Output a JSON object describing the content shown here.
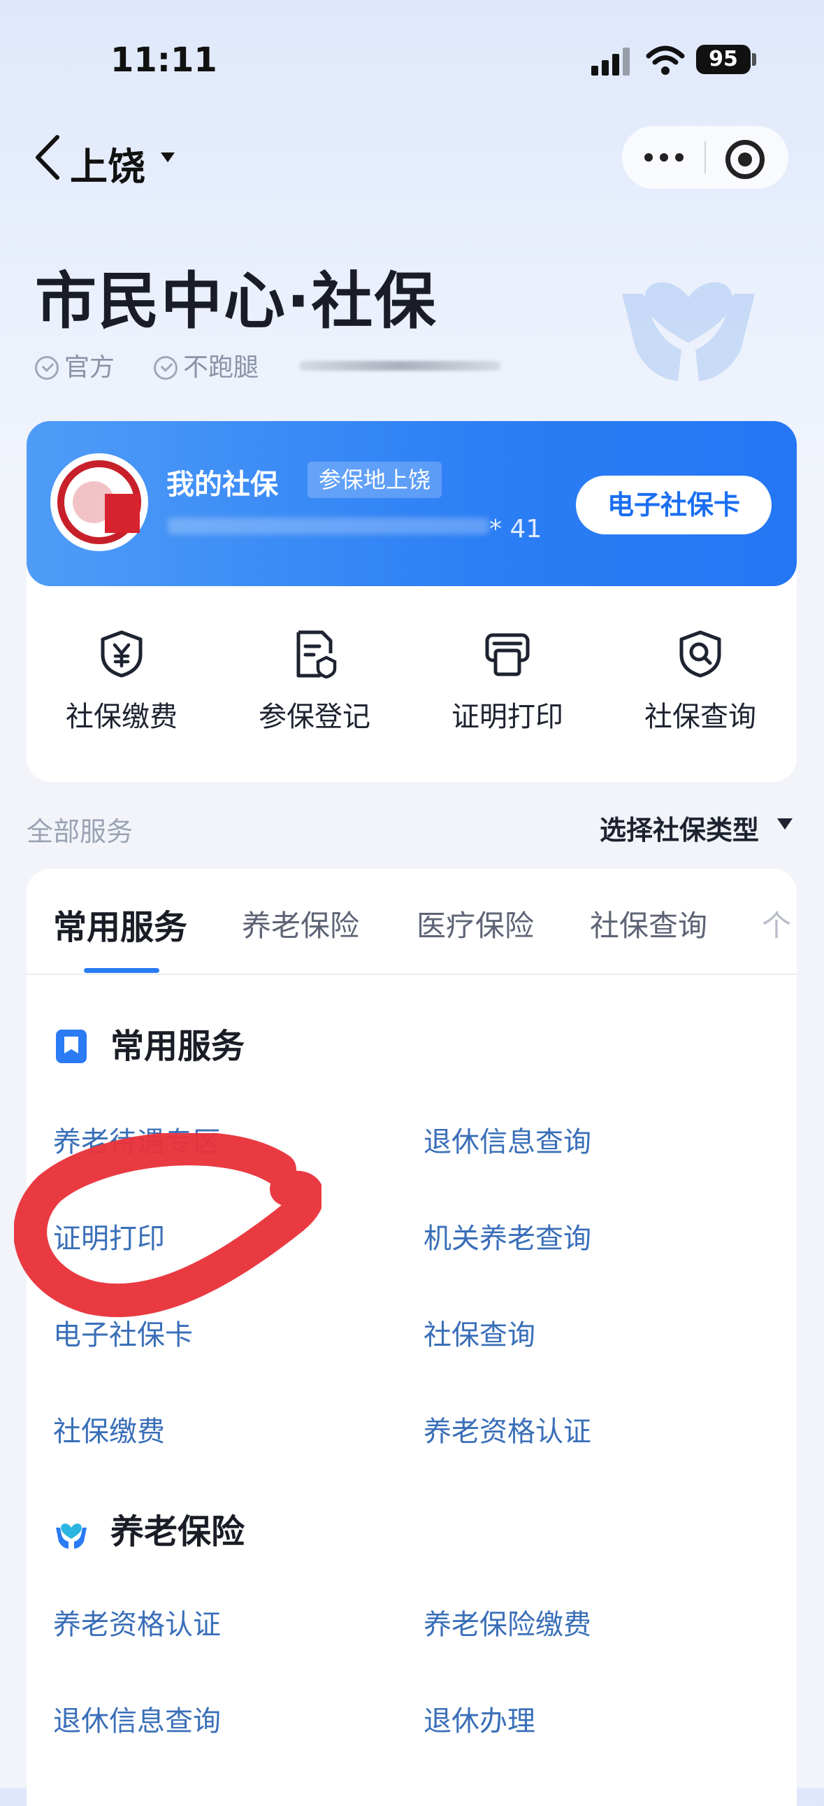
{
  "status_bar": {
    "time": "11:11",
    "battery": "95"
  },
  "nav": {
    "city": "上饶"
  },
  "header": {
    "title": "市民中心·社保",
    "badges": [
      "官方",
      "不跑腿"
    ]
  },
  "card": {
    "label": "我的社保",
    "location_tag": "参保地上饶",
    "number_suffix": "* 41",
    "ecard_button": "电子社保卡",
    "accent": "#2c7ef5"
  },
  "quick_actions": [
    {
      "label": "社保缴费",
      "icon": "yuan-shield-icon"
    },
    {
      "label": "参保登记",
      "icon": "document-badge-icon"
    },
    {
      "label": "证明打印",
      "icon": "printer-icon"
    },
    {
      "label": "社保查询",
      "icon": "search-shield-icon"
    }
  ],
  "services": {
    "header": "全部服务",
    "type_select": "选择社保类型",
    "tabs": [
      "常用服务",
      "养老保险",
      "医疗保险",
      "社保查询",
      "个"
    ],
    "sections": [
      {
        "title": "常用服务",
        "icon": "bookmark-icon",
        "items": [
          "养老待遇专区",
          "退休信息查询",
          "证明打印",
          "机关养老查询",
          "电子社保卡",
          "社保查询",
          "社保缴费",
          "养老资格认证"
        ]
      },
      {
        "title": "养老保险",
        "icon": "care-hands-icon",
        "items": [
          "养老资格认证",
          "养老保险缴费",
          "退休信息查询",
          "退休办理"
        ]
      }
    ]
  }
}
